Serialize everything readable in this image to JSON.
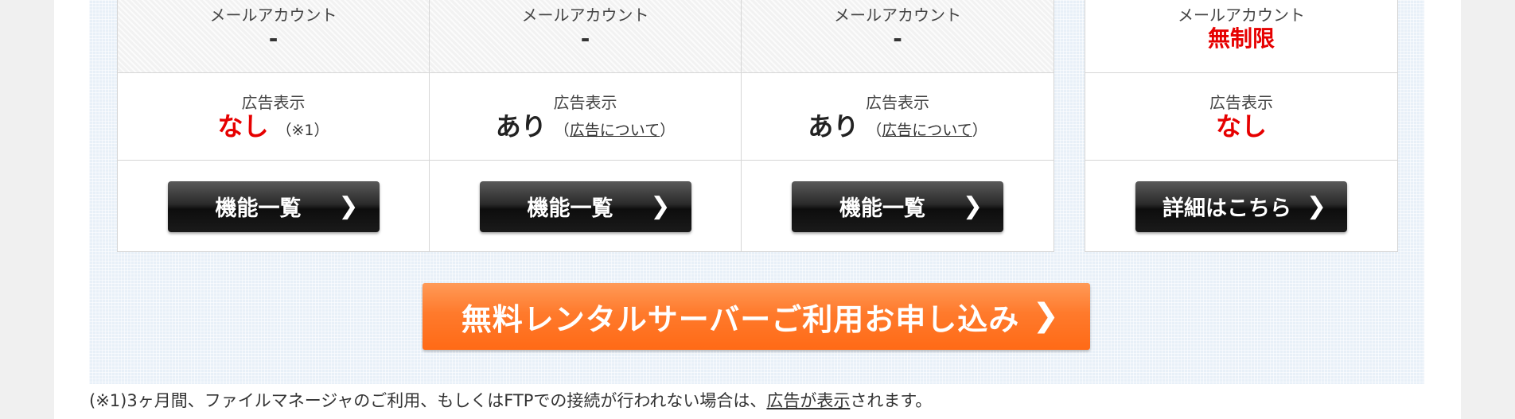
{
  "plans": [
    {
      "mail_label": "メールアカウント",
      "mail_value": "-",
      "ad_label": "広告表示",
      "ad_value": "なし",
      "ad_note": "（※1）",
      "button_label": "機能一覧"
    },
    {
      "mail_label": "メールアカウント",
      "mail_value": "-",
      "ad_label": "広告表示",
      "ad_value": "あり",
      "ad_note_open": "（",
      "ad_note_link": "広告について",
      "ad_note_close": "）",
      "button_label": "機能一覧"
    },
    {
      "mail_label": "メールアカウント",
      "mail_value": "-",
      "ad_label": "広告表示",
      "ad_value": "あり",
      "ad_note_open": "（",
      "ad_note_link": "広告について",
      "ad_note_close": "）",
      "button_label": "機能一覧"
    },
    {
      "mail_label": "メールアカウント",
      "mail_value": "無制限",
      "ad_label": "広告表示",
      "ad_value": "なし",
      "button_label": "詳細はこちら"
    }
  ],
  "cta": {
    "label": "無料レンタルサーバーご利用お申し込み"
  },
  "footnote": {
    "prefix": "(※1)3ヶ月間、ファイルマネージャのご利用、もしくはFTPでの接続が行われない場合は、",
    "link": "広告が表示",
    "suffix": "されます。"
  },
  "icons": {
    "button_arrow": "chevron-right-icon"
  },
  "colors": {
    "accent_red": "#e60000",
    "cta_orange": "#ff7a2c",
    "button_black": "#1a1a1a"
  }
}
